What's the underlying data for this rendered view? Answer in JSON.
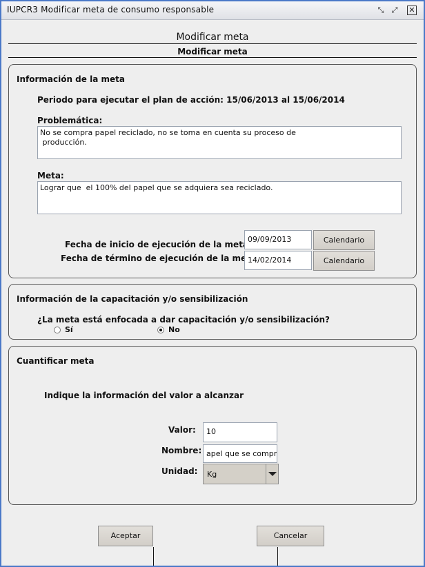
{
  "window": {
    "title": "IUPCR3 Modificar meta de consumo responsable",
    "border_color": "#4a78c8"
  },
  "headers": {
    "main": "Modificar meta",
    "sub": "Modificar meta"
  },
  "meta_info": {
    "title": "Información de la meta",
    "periodo": "Periodo para ejecutar el plan de acción: 15/06/2013 al 15/06/2014",
    "problematica_label": "Problemática:",
    "problematica_value": "No se compra papel reciclado, no se toma en cuenta su proceso de\n producción.",
    "meta_label": "Meta:",
    "meta_value": "Lograr que  el 100% del papel que se adquiera sea reciclado.",
    "fecha_inicio_label": "Fecha de inicio de ejecución de la meta:",
    "fecha_inicio_value": "09/09/2013",
    "fecha_termino_label": "Fecha de término de ejecución de la meta:",
    "fecha_termino_value": "14/02/2014",
    "calendario_label": "Calendario"
  },
  "capacitacion": {
    "title": "Información de la capacitación y/o sensibilización",
    "question": "¿La meta está enfocada a dar capacitación y/o sensibilización?",
    "options": [
      {
        "label": "Sí",
        "selected": false
      },
      {
        "label": "No",
        "selected": true
      }
    ]
  },
  "cuantificar": {
    "title": "Cuantificar meta",
    "instruction": "Indique la información del valor a alcanzar",
    "valor_label": "Valor:",
    "valor_value": "10",
    "nombre_label": "Nombre:",
    "nombre_value": "apel que se compra",
    "unidad_label": "Unidad:",
    "unidad_value": "Kg"
  },
  "actions": {
    "aceptar_label": "Aceptar",
    "cancelar_label": "Cancelar"
  }
}
